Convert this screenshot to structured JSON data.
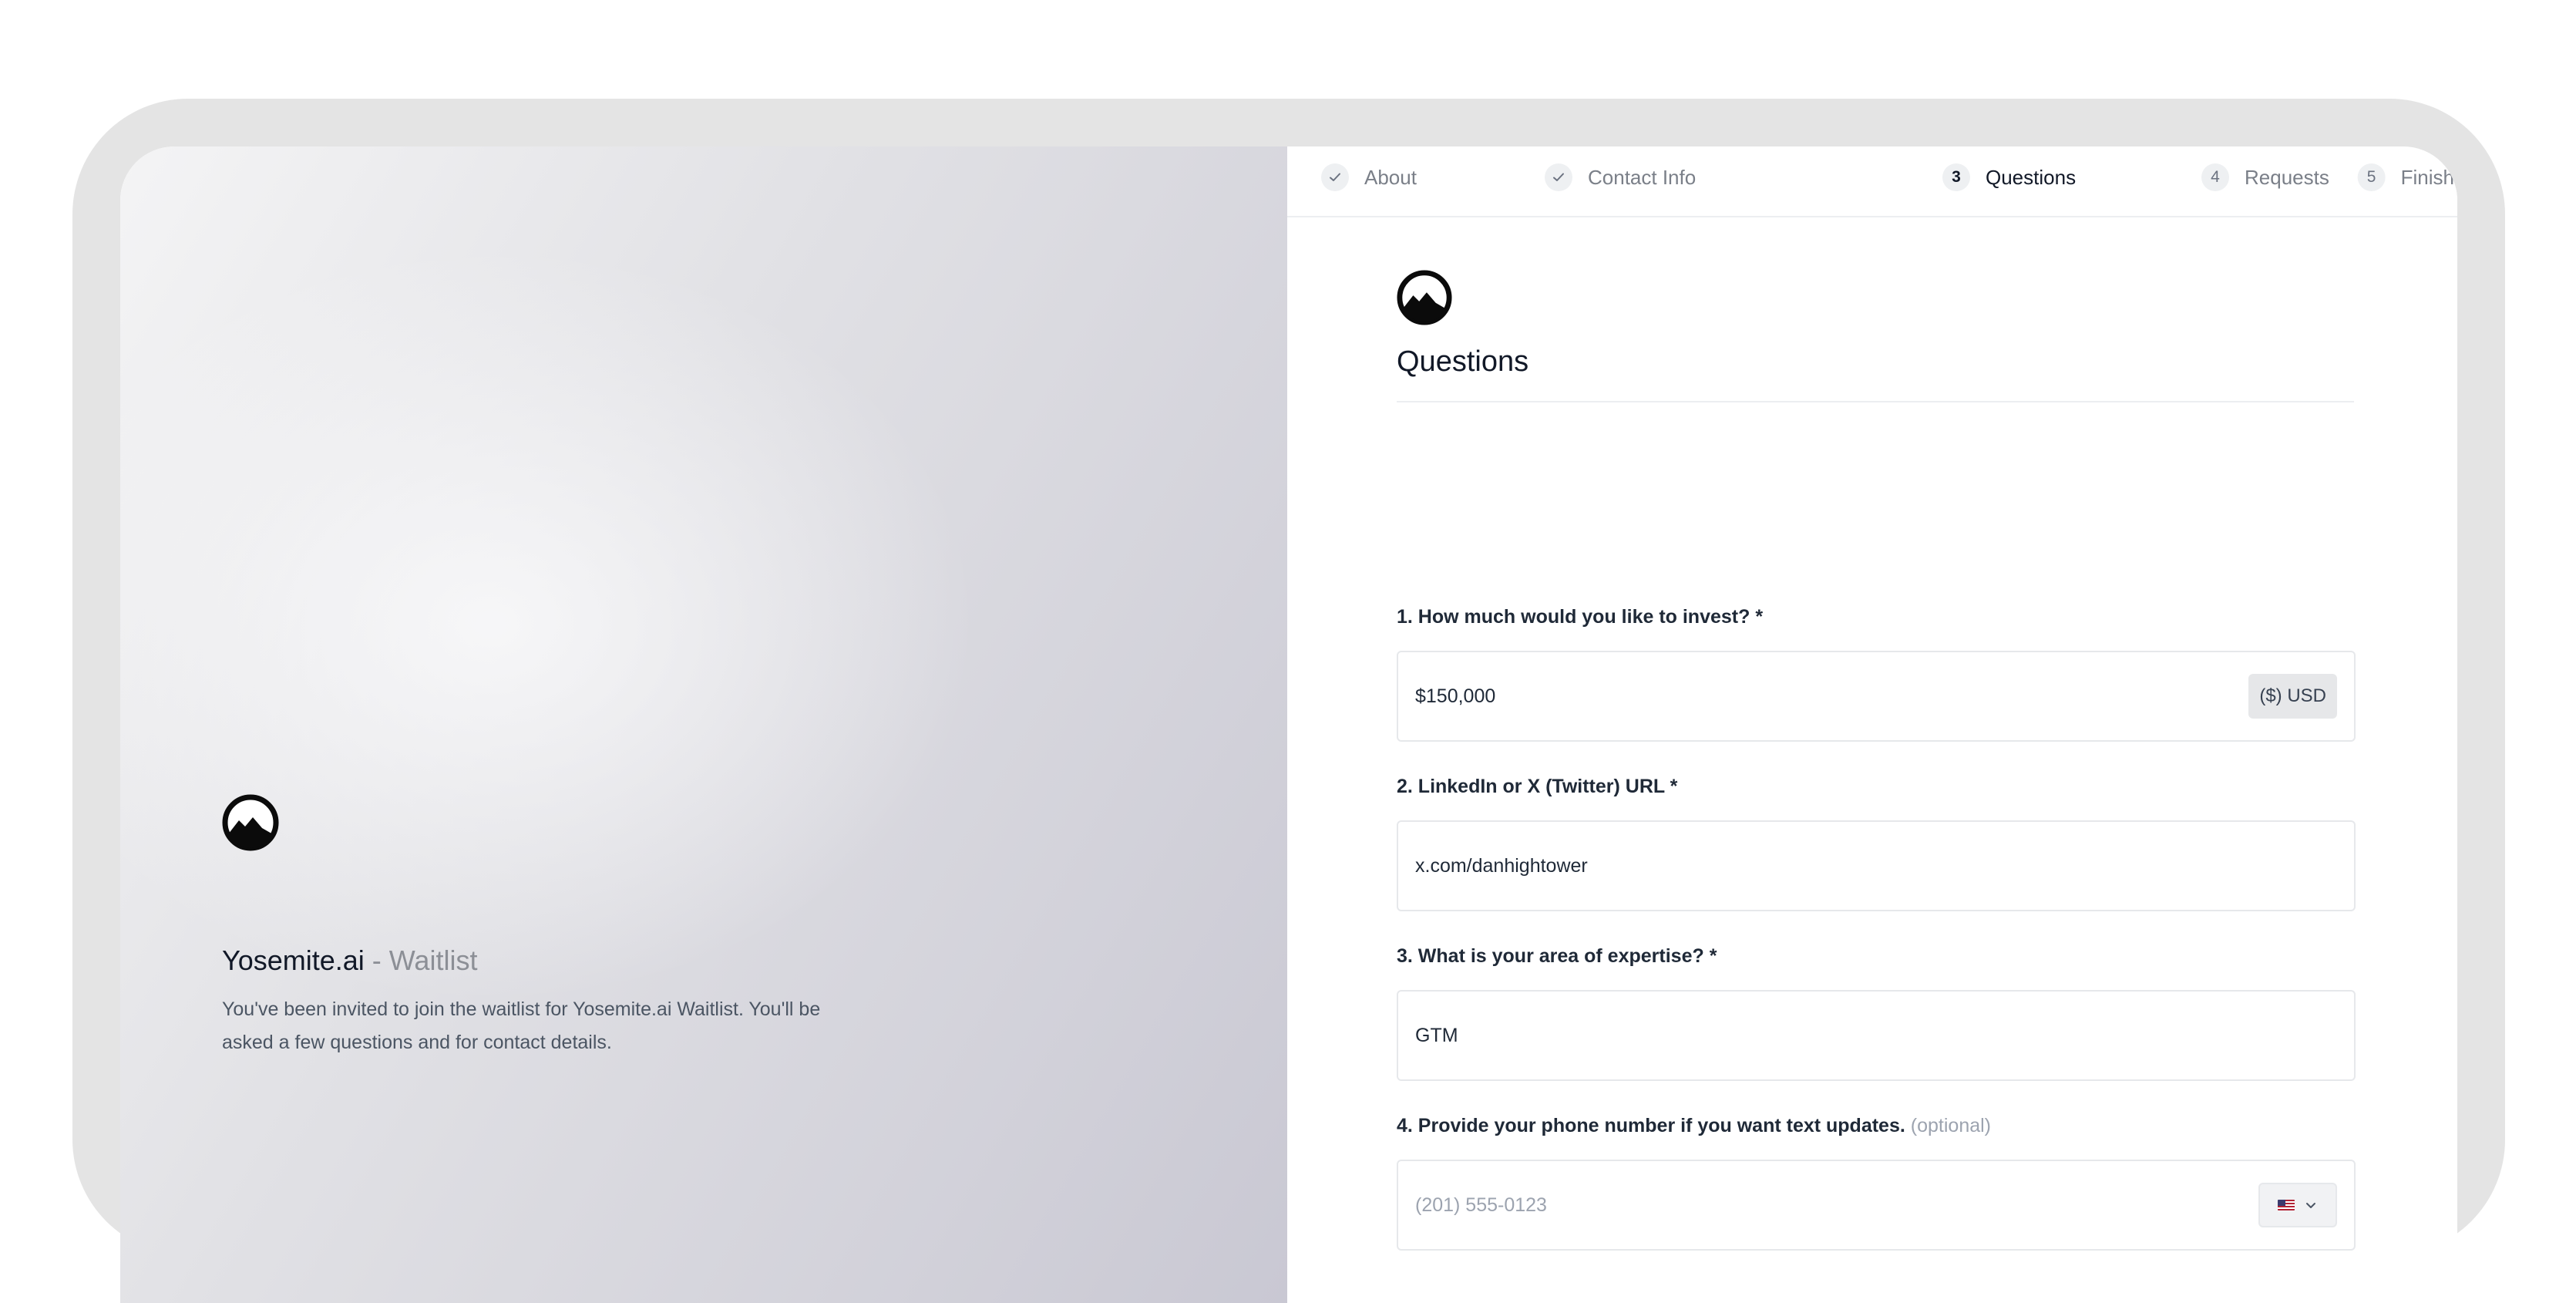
{
  "brand": {
    "name": "Yosemite.ai",
    "suffix": "- Waitlist",
    "description": "You've been invited to join the waitlist for Yosemite.ai Waitlist. You'll be asked a few questions and for contact details."
  },
  "stepper": {
    "steps": [
      {
        "badge": "✓",
        "label": "About",
        "state": "completed"
      },
      {
        "badge": "✓",
        "label": "Contact Info",
        "state": "completed"
      },
      {
        "badge": "3",
        "label": "Questions",
        "state": "active"
      },
      {
        "badge": "4",
        "label": "Requests",
        "state": "upcoming"
      },
      {
        "badge": "5",
        "label": "Finish",
        "state": "upcoming"
      }
    ]
  },
  "form": {
    "title": "Questions",
    "questions": [
      {
        "label": "1. How much would you like to invest? *",
        "value": "$150,000",
        "suffix": "($) USD"
      },
      {
        "label": "2. LinkedIn or X (Twitter) URL *",
        "value": "x.com/danhightower"
      },
      {
        "label": "3. What is your area of expertise? *",
        "value": "GTM"
      },
      {
        "label": "4. Provide your phone number if you want text updates.",
        "optional": "(optional)",
        "placeholder": "(201) 555-0123",
        "country_icon": "us-flag-icon"
      }
    ]
  },
  "colors": {
    "text_primary": "#111827",
    "text_muted": "#8c8f96",
    "border": "#e6e8eb",
    "frame": "#e4e4e4"
  }
}
